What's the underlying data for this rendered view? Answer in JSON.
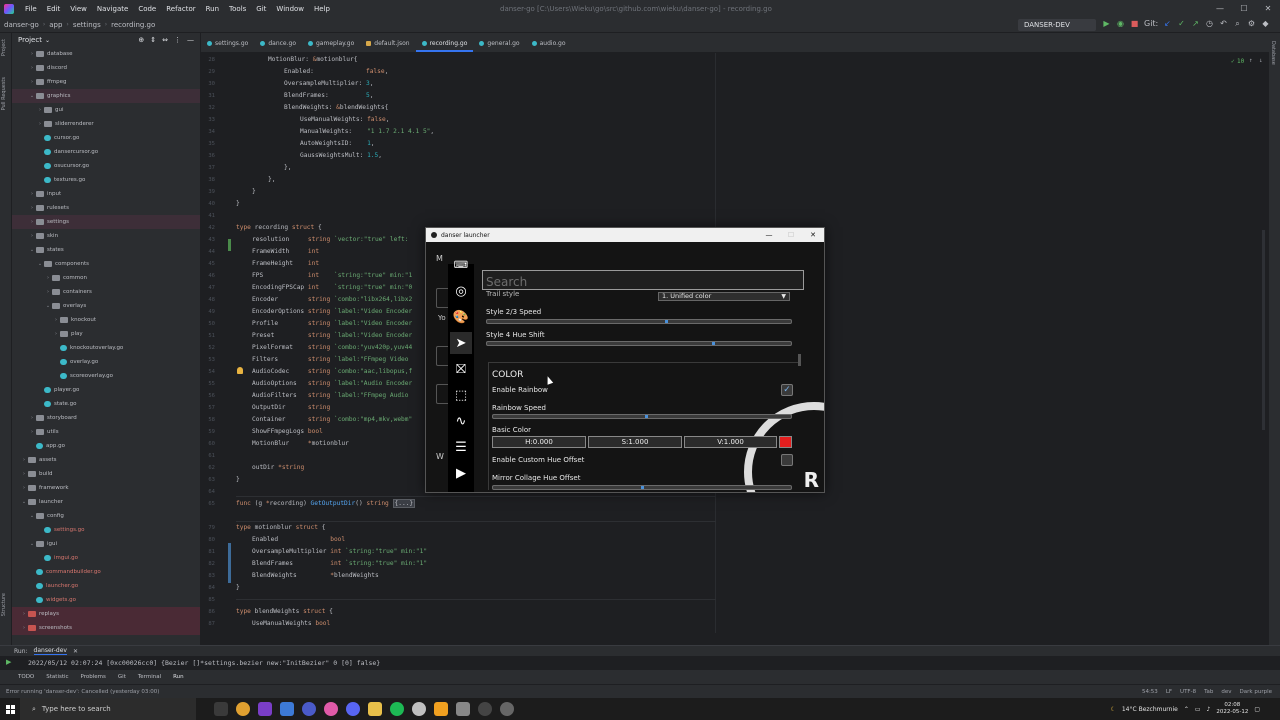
{
  "menubar": {
    "items": [
      "File",
      "Edit",
      "View",
      "Navigate",
      "Code",
      "Refactor",
      "Run",
      "Tools",
      "Git",
      "Window",
      "Help"
    ],
    "title": "danser-go [C:\\Users\\Wieku\\go\\src\\github.com\\wieku\\danser-go] - recording.go"
  },
  "navbar": {
    "crumbs": [
      "danser-go",
      "app",
      "settings",
      "recording.go"
    ],
    "run_config": "DANSER-DEV",
    "git_label": "Git:"
  },
  "project": {
    "header": "Project",
    "tree": [
      {
        "label": "database",
        "indent": 2,
        "type": "folder",
        "arrow": "›"
      },
      {
        "label": "discord",
        "indent": 2,
        "type": "folder",
        "arrow": "›"
      },
      {
        "label": "ffmpeg",
        "indent": 2,
        "type": "folder",
        "arrow": "›"
      },
      {
        "label": "graphics",
        "indent": 2,
        "type": "folder",
        "arrow": "⌄",
        "hl": true
      },
      {
        "label": "gui",
        "indent": 3,
        "type": "folder",
        "arrow": "›"
      },
      {
        "label": "sliderrenderer",
        "indent": 3,
        "type": "folder",
        "arrow": "›"
      },
      {
        "label": "cursor.go",
        "indent": 3,
        "type": "go"
      },
      {
        "label": "dansercursor.go",
        "indent": 3,
        "type": "go"
      },
      {
        "label": "osucursor.go",
        "indent": 3,
        "type": "go"
      },
      {
        "label": "textures.go",
        "indent": 3,
        "type": "go"
      },
      {
        "label": "input",
        "indent": 2,
        "type": "folder",
        "arrow": "›"
      },
      {
        "label": "rulesets",
        "indent": 2,
        "type": "folder",
        "arrow": "›"
      },
      {
        "label": "settings",
        "indent": 2,
        "type": "folder",
        "arrow": "›",
        "hl": true
      },
      {
        "label": "skin",
        "indent": 2,
        "type": "folder",
        "arrow": "›"
      },
      {
        "label": "states",
        "indent": 2,
        "type": "folder",
        "arrow": "⌄"
      },
      {
        "label": "components",
        "indent": 3,
        "type": "folder",
        "arrow": "⌄"
      },
      {
        "label": "common",
        "indent": 4,
        "type": "folder",
        "arrow": "›"
      },
      {
        "label": "containers",
        "indent": 4,
        "type": "folder",
        "arrow": "›"
      },
      {
        "label": "overlays",
        "indent": 4,
        "type": "folder",
        "arrow": "⌄"
      },
      {
        "label": "knockout",
        "indent": 5,
        "type": "folder",
        "arrow": "›"
      },
      {
        "label": "play",
        "indent": 5,
        "type": "folder",
        "arrow": "›"
      },
      {
        "label": "knockoutoverlay.go",
        "indent": 5,
        "type": "go"
      },
      {
        "label": "overlay.go",
        "indent": 5,
        "type": "go"
      },
      {
        "label": "scoreoverlay.go",
        "indent": 5,
        "type": "go"
      },
      {
        "label": "player.go",
        "indent": 3,
        "type": "go"
      },
      {
        "label": "state.go",
        "indent": 3,
        "type": "go"
      },
      {
        "label": "storyboard",
        "indent": 2,
        "type": "folder",
        "arrow": "›"
      },
      {
        "label": "utils",
        "indent": 2,
        "type": "folder",
        "arrow": "›"
      },
      {
        "label": "app.go",
        "indent": 2,
        "type": "go"
      },
      {
        "label": "assets",
        "indent": 1,
        "type": "folder",
        "arrow": "›"
      },
      {
        "label": "build",
        "indent": 1,
        "type": "folder",
        "arrow": "›"
      },
      {
        "label": "framework",
        "indent": 1,
        "type": "folder",
        "arrow": "›"
      },
      {
        "label": "launcher",
        "indent": 1,
        "type": "folder",
        "arrow": "⌄"
      },
      {
        "label": "config",
        "indent": 2,
        "type": "folder",
        "arrow": "⌄"
      },
      {
        "label": "settings.go",
        "indent": 3,
        "type": "go",
        "red": true
      },
      {
        "label": "igui",
        "indent": 2,
        "type": "folder",
        "arrow": "⌄"
      },
      {
        "label": "imgui.go",
        "indent": 3,
        "type": "go",
        "red": true
      },
      {
        "label": "commandbuilder.go",
        "indent": 2,
        "type": "go",
        "red": true
      },
      {
        "label": "launcher.go",
        "indent": 2,
        "type": "go",
        "red": true
      },
      {
        "label": "widgets.go",
        "indent": 2,
        "type": "go",
        "red": true
      },
      {
        "label": "replays",
        "indent": 1,
        "type": "redfolder",
        "arrow": "›",
        "pink": true
      },
      {
        "label": "screenshots",
        "indent": 1,
        "type": "redfolder",
        "arrow": "›",
        "pink": true
      }
    ]
  },
  "tabs": [
    {
      "label": "settings.go",
      "kind": "go"
    },
    {
      "label": "dance.go",
      "kind": "go"
    },
    {
      "label": "gameplay.go",
      "kind": "go"
    },
    {
      "label": "default.json",
      "kind": "json"
    },
    {
      "label": "recording.go",
      "kind": "go",
      "active": true
    },
    {
      "label": "general.go",
      "kind": "go"
    },
    {
      "label": "audio.go",
      "kind": "go"
    }
  ],
  "editor": {
    "line_numbers": [
      "28",
      "29",
      "30",
      "31",
      "32",
      "33",
      "34",
      "35",
      "36",
      "37",
      "38",
      "39",
      "40",
      "41",
      "42",
      "43",
      "44",
      "45",
      "46",
      "47",
      "48",
      "49",
      "50",
      "51",
      "52",
      "53",
      "54",
      "55",
      "56",
      "57",
      "58",
      "59",
      "60",
      "61",
      "62",
      "63",
      "64",
      "65",
      "",
      "79",
      "80",
      "81",
      "82",
      "83",
      "84",
      "85",
      "86",
      "87",
      "88"
    ],
    "footer_label": "recording",
    "inspection_count": "10"
  },
  "launcher": {
    "title": "danser launcher",
    "search_placeholder": "Search",
    "trail_style_label": "Trail style",
    "trail_style_value": "1. Unified color",
    "style23_label": "Style 2/3 Speed",
    "style4_label": "Style 4 Hue Shift",
    "section": "COLOR",
    "enable_rainbow": "Enable Rainbow",
    "rainbow_checked": true,
    "rainbow_speed": "Rainbow Speed",
    "basic_color": "Basic Color",
    "h": "H:0.000",
    "s": "S:1.000",
    "v": "V:1.000",
    "swatch_color": "#e41e1e",
    "custom_hue": "Enable Custom Hue Offset",
    "mirror_hue": "Mirror Collage Hue Offset",
    "left_fragments": [
      "M",
      "Yo",
      "W"
    ]
  },
  "runpanel": {
    "label": "Run:",
    "tab": "danser-dev",
    "output": "2022/05/12 02:07:24 [0xc00026cc0] {Bezier  []*settings.bezier new:\"InitBezier\" 0 [0] false}"
  },
  "bottom_tools": [
    "TODO",
    "Statistic",
    "Problems",
    "Git",
    "Terminal",
    "Run"
  ],
  "status": {
    "message": "Error running 'danser-dev': Cancelled (yesterday 03:00)",
    "right": [
      "54:53",
      "LF",
      "UTF-8",
      "Tab",
      "dev",
      "Dark purple"
    ]
  },
  "taskbar": {
    "search_placeholder": "Type here to search",
    "weather": "14°C  Bezchmurnie",
    "time": "02:08",
    "date": "2022-05-12"
  }
}
